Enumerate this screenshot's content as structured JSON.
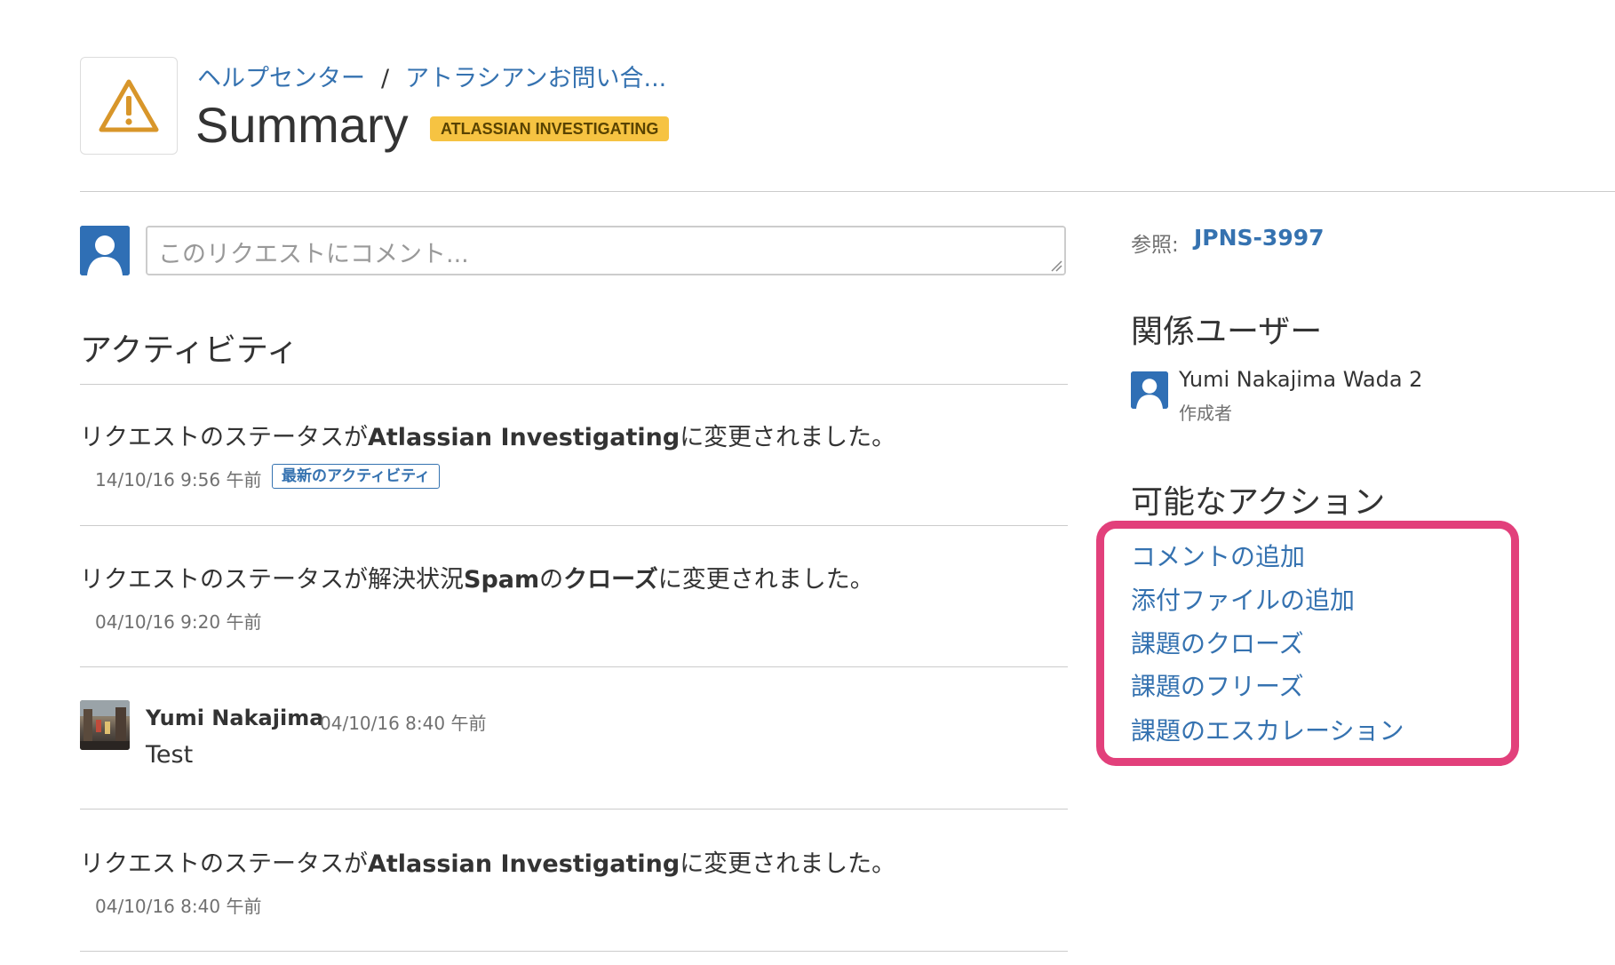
{
  "header": {
    "breadcrumb": [
      "ヘルプセンター",
      "アトラシアンお問い合..."
    ],
    "breadcrumb_separator": "/",
    "title": "Summary",
    "status": "ATLASSIAN INVESTIGATING",
    "icon": "warning-icon"
  },
  "comment_box": {
    "placeholder": "このリクエストにコメント..."
  },
  "activity": {
    "heading": "アクティビティ",
    "latest_badge": "最新のアクティビティ",
    "items": [
      {
        "prefix": "リクエストのステータスが",
        "bold": "Atlassian Investigating",
        "suffix": "に変更されました。",
        "date": "14/10/16 9:56 午前"
      },
      {
        "prefix": "リクエストのステータスが解決状況",
        "bold": "Spam",
        "middle": "の",
        "bold2": "クローズ",
        "suffix": "に変更されました。",
        "date": "04/10/16 9:20 午前"
      },
      {
        "author": "Yumi Nakajima",
        "date": "04/10/16 8:40 午前",
        "body": "Test"
      },
      {
        "prefix": "リクエストのステータスが",
        "bold": "Atlassian Investigating",
        "suffix": "に変更されました。",
        "date": "04/10/16 8:40 午前"
      }
    ]
  },
  "sidebar": {
    "reference_label": "参照:",
    "reference_key": "JPNS-3997",
    "participants_heading": "関係ユーザー",
    "participant": {
      "name": "Yumi Nakajima Wada 2",
      "role": "作成者"
    },
    "actions_heading": "可能なアクション",
    "actions": [
      "コメントの追加",
      "添付ファイルの追加",
      "課題のクローズ",
      "課題のフリーズ",
      "課題のエスカレーション"
    ]
  },
  "colors": {
    "link": "#3572b0",
    "status_lozenge": "#f6c342",
    "highlight": "#e2407b",
    "warning_icon": "#d8962a"
  }
}
